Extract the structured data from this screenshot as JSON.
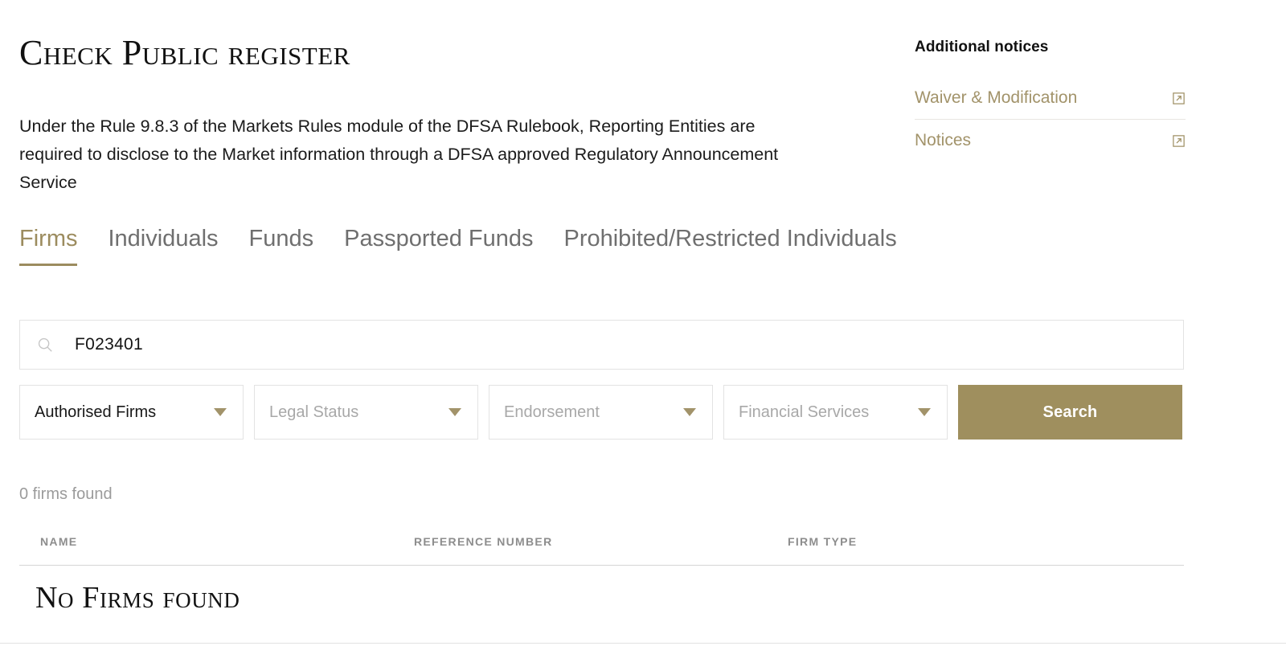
{
  "header": {
    "title": "Check Public register",
    "intro": "Under the Rule 9.8.3 of the Markets Rules module of the DFSA Rulebook, Reporting Entities are required to disclose to the Market information through a DFSA approved Regulatory Announcement Service"
  },
  "sidebar": {
    "title": "Additional notices",
    "items": [
      {
        "label": "Waiver & Modification",
        "icon": "external-link-icon"
      },
      {
        "label": "Notices",
        "icon": "external-link-icon"
      }
    ]
  },
  "tabs": [
    {
      "label": "Firms",
      "active": true
    },
    {
      "label": "Individuals",
      "active": false
    },
    {
      "label": "Funds",
      "active": false
    },
    {
      "label": "Passported Funds",
      "active": false
    },
    {
      "label": "Prohibited/Restricted Individuals",
      "active": false
    }
  ],
  "search": {
    "icon": "search-icon",
    "value": "F023401",
    "placeholder": "",
    "button_label": "Search"
  },
  "filters": [
    {
      "name": "firm-category",
      "value": "Authorised Firms",
      "placeholder": "Authorised Firms",
      "filled": true
    },
    {
      "name": "legal-status",
      "value": "",
      "placeholder": "Legal Status",
      "filled": false
    },
    {
      "name": "endorsement",
      "value": "",
      "placeholder": "Endorsement",
      "filled": false
    },
    {
      "name": "financial-services",
      "value": "",
      "placeholder": "Financial Services",
      "filled": false
    }
  ],
  "results": {
    "count_text": "0 firms found",
    "columns": [
      "NAME",
      "REFERENCE NUMBER",
      "FIRM TYPE"
    ],
    "rows": [],
    "empty_message": "No Firms found"
  },
  "colors": {
    "gold": "#9f8f5e",
    "gold_text": "#a2936a",
    "body_text": "#1b1b1b",
    "muted": "#9b9b9b",
    "border": "#e3e3e3"
  }
}
